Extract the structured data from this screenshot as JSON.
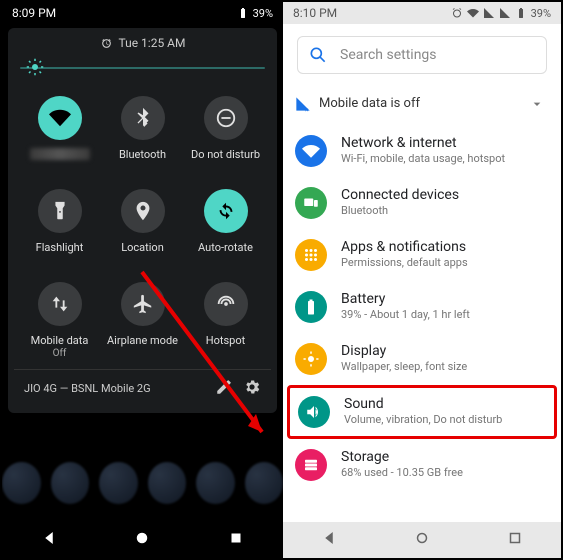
{
  "left": {
    "status_time": "8:09 PM",
    "battery_pct": "39%",
    "alarm_time": "Tue 1:25 AM",
    "tiles": {
      "wifi": {
        "label": ""
      },
      "bluetooth": {
        "label": "Bluetooth"
      },
      "dnd": {
        "label": "Do not disturb"
      },
      "flashlight": {
        "label": "Flashlight"
      },
      "location": {
        "label": "Location"
      },
      "autorotate": {
        "label": "Auto-rotate"
      },
      "mobiledata": {
        "label": "Mobile data",
        "sub": "Off"
      },
      "airplane": {
        "label": "Airplane mode"
      },
      "hotspot": {
        "label": "Hotspot"
      }
    },
    "footer_carrier": "JIO 4G — BSNL Mobile 2G"
  },
  "right": {
    "status_time": "8:10 PM",
    "battery_pct": "39%",
    "search_placeholder": "Search settings",
    "suggestion": "Mobile data is off",
    "items": {
      "network": {
        "title": "Network & internet",
        "sub": "Wi-Fi, mobile, data usage, hotspot"
      },
      "connected": {
        "title": "Connected devices",
        "sub": "Bluetooth"
      },
      "apps": {
        "title": "Apps & notifications",
        "sub": "Permissions, default apps"
      },
      "battery": {
        "title": "Battery",
        "sub": "39% - About 1 day, 1 hr left"
      },
      "display": {
        "title": "Display",
        "sub": "Wallpaper, sleep, font size"
      },
      "sound": {
        "title": "Sound",
        "sub": "Volume, vibration, Do not disturb"
      },
      "storage": {
        "title": "Storage",
        "sub": "68% used - 10.35 GB free"
      }
    }
  }
}
